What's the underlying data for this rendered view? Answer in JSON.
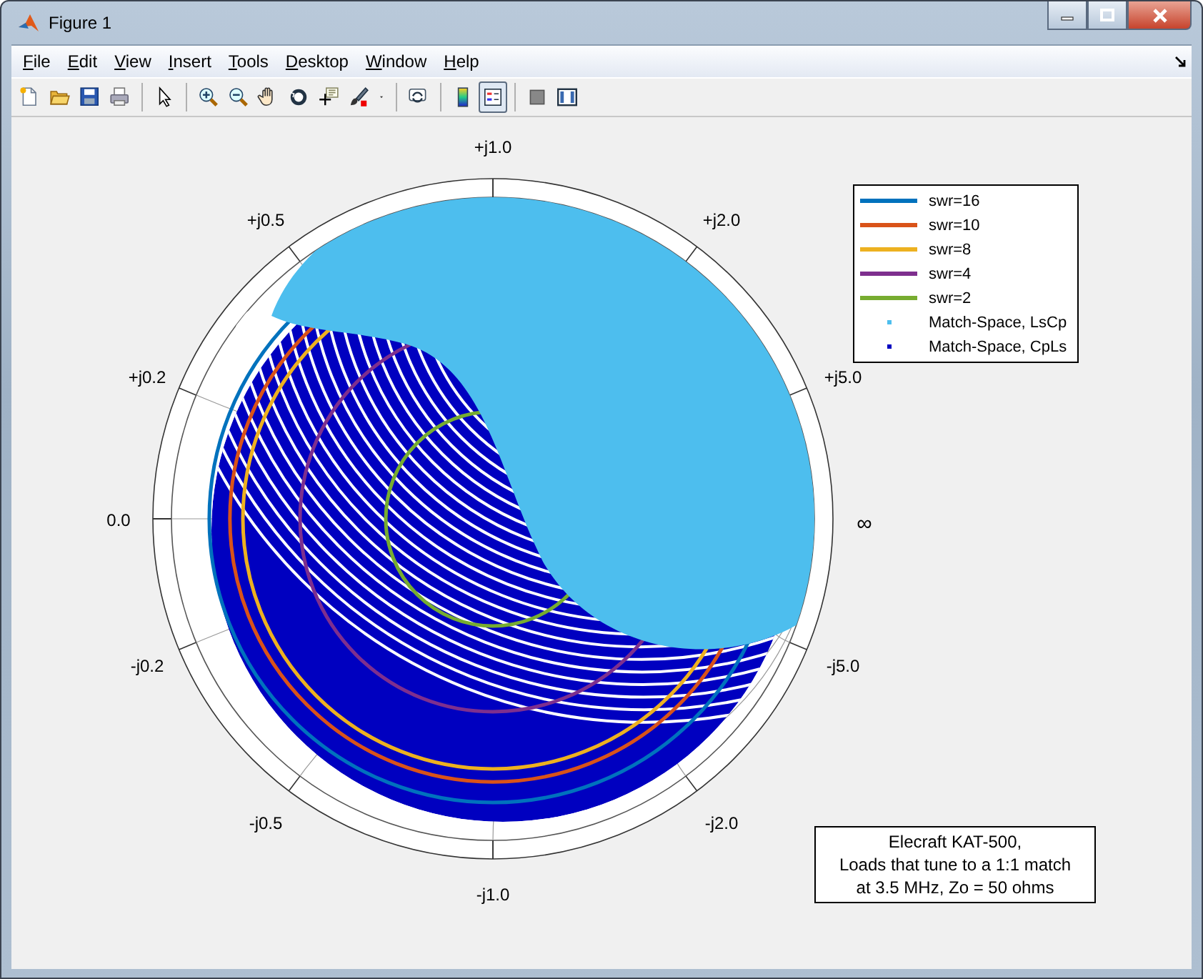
{
  "window": {
    "title": "Figure 1"
  },
  "menu": [
    {
      "label": "File"
    },
    {
      "label": "Edit"
    },
    {
      "label": "View"
    },
    {
      "label": "Insert"
    },
    {
      "label": "Tools"
    },
    {
      "label": "Desktop"
    },
    {
      "label": "Window"
    },
    {
      "label": "Help"
    }
  ],
  "toggles": [
    {
      "kind": "colorbar",
      "selected": false
    },
    {
      "kind": "legend",
      "selected": true
    }
  ],
  "chart": {
    "axis_labels": [
      {
        "text": "+j1.0",
        "kind": "top"
      },
      {
        "text": "+j0.5",
        "kind": "ul"
      },
      {
        "text": "+j2.0",
        "kind": "ur"
      },
      {
        "text": "+j0.2",
        "kind": "ml"
      },
      {
        "text": "+j5.0",
        "kind": "mr"
      },
      {
        "text": "0.0",
        "kind": "left"
      },
      {
        "text": "∞",
        "kind": "right"
      },
      {
        "text": "-j0.2",
        "kind": "bl"
      },
      {
        "text": "-j5.0",
        "kind": "br"
      },
      {
        "text": "-j0.5",
        "kind": "ll"
      },
      {
        "text": "-j2.0",
        "kind": "lr"
      },
      {
        "text": "-j1.0",
        "kind": "bottom"
      }
    ],
    "legend": [
      {
        "label": "swr=16",
        "kind": "line",
        "color": "#0072bd"
      },
      {
        "label": "swr=10",
        "kind": "line",
        "color": "#d95319"
      },
      {
        "label": "swr=8",
        "kind": "line",
        "color": "#edb120"
      },
      {
        "label": "swr=4",
        "kind": "line",
        "color": "#7e2f8e"
      },
      {
        "label": "swr=2",
        "kind": "line",
        "color": "#77ac30"
      },
      {
        "label": "Match-Space, LsCp",
        "kind": "marker",
        "color": "#4dbeee"
      },
      {
        "label": "Match-Space, CpLs",
        "kind": "marker",
        "color": "#0000c0"
      }
    ],
    "annotation": [
      "Elecraft KAT-500,",
      "Loads that tune to a 1:1 match",
      "at 3.5 MHz, Zo = 50 ohms"
    ]
  }
}
